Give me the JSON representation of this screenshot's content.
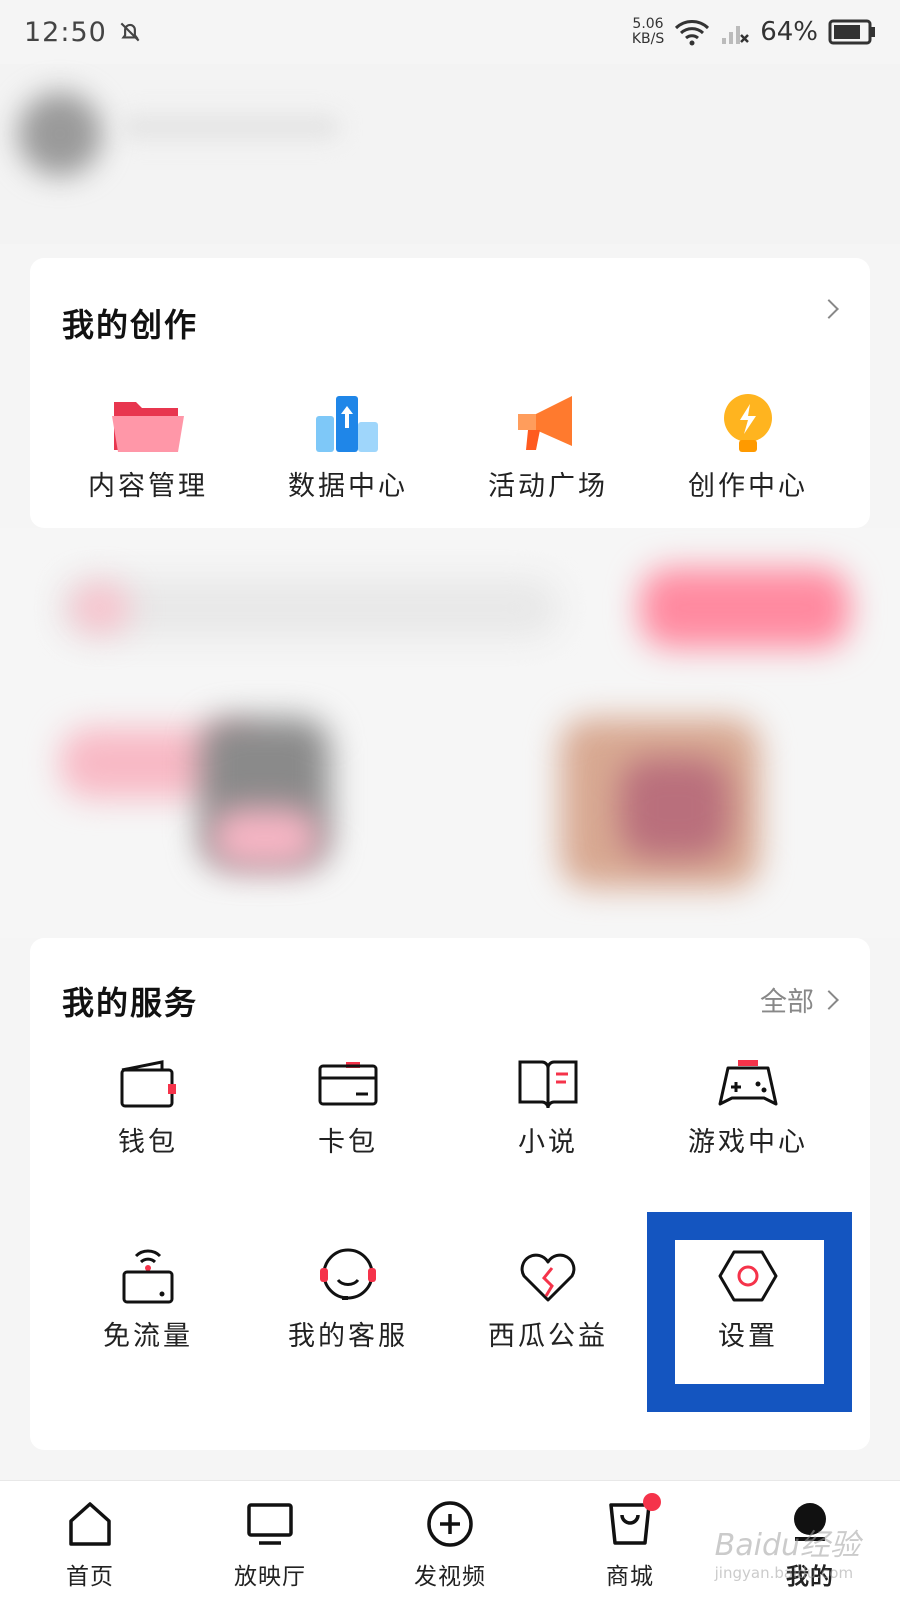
{
  "status": {
    "time": "12:50",
    "speed_value": "5.06",
    "speed_unit": "KB/S",
    "battery": "64%"
  },
  "creation": {
    "title": "我的创作",
    "items": [
      {
        "label": "内容管理",
        "icon": "folder-icon"
      },
      {
        "label": "数据中心",
        "icon": "data-chart-icon"
      },
      {
        "label": "活动广场",
        "icon": "megaphone-icon"
      },
      {
        "label": "创作中心",
        "icon": "lightbulb-icon"
      }
    ]
  },
  "services": {
    "title": "我的服务",
    "more_label": "全部",
    "items": [
      {
        "label": "钱包",
        "icon": "wallet-icon"
      },
      {
        "label": "卡包",
        "icon": "card-icon"
      },
      {
        "label": "小说",
        "icon": "book-icon"
      },
      {
        "label": "游戏中心",
        "icon": "gamepad-icon"
      },
      {
        "label": "免流量",
        "icon": "free-data-icon"
      },
      {
        "label": "我的客服",
        "icon": "headset-icon"
      },
      {
        "label": "西瓜公益",
        "icon": "heart-icon"
      },
      {
        "label": "设置",
        "icon": "settings-icon"
      }
    ]
  },
  "bottom_nav": [
    {
      "label": "首页",
      "icon": "home-icon"
    },
    {
      "label": "放映厅",
      "icon": "tv-icon"
    },
    {
      "label": "发视频",
      "icon": "add-video-icon"
    },
    {
      "label": "商城",
      "icon": "shopping-bag-icon"
    },
    {
      "label": "我的",
      "icon": "profile-icon"
    }
  ],
  "watermark": {
    "brand": "Baidu经验",
    "url": "jingyan.baidu.com"
  },
  "colors": {
    "accent": "#f5334a",
    "highlight": "#1455c0"
  }
}
